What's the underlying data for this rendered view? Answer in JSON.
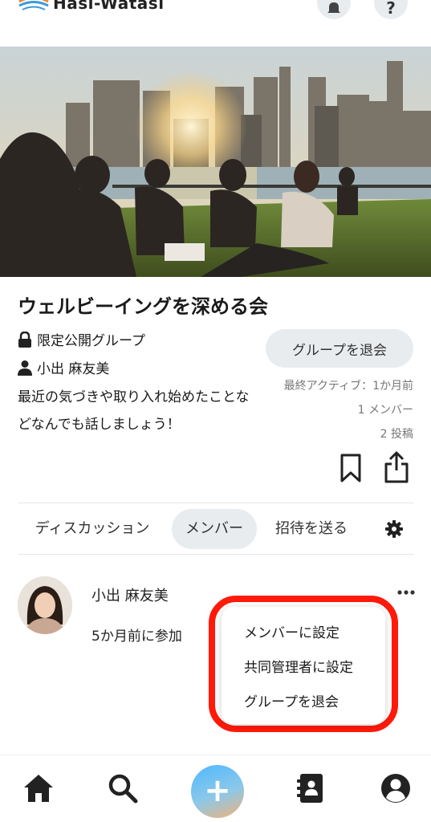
{
  "header": {
    "app_name": "Hasi-Watasi",
    "icons": [
      "logo-icon",
      "bell-icon",
      "help-icon"
    ],
    "help_symbol": "?"
  },
  "group": {
    "title": "ウェルビーイングを深める会",
    "privacy": "限定公開グループ",
    "owner": "小出 麻友美",
    "description": "最近の気づきや取り入れ始めたことなどなんでも話しましょう！",
    "leave_button": "グループを退会",
    "last_active": "最終アクティブ：1か月前",
    "member_count": "1 メンバー",
    "post_count": "2 投稿"
  },
  "tabs": [
    {
      "label": "ディスカッション",
      "active": false
    },
    {
      "label": "メンバー",
      "active": true
    },
    {
      "label": "招待を送る",
      "active": false
    }
  ],
  "member": {
    "name": "小出 麻友美",
    "joined": "5か月前に参加"
  },
  "context_menu": {
    "items": [
      "メンバーに設定",
      "共同管理者に設定",
      "グループを退会"
    ]
  },
  "bottom_nav": {
    "items": [
      "home-icon",
      "search-icon",
      "add-icon",
      "contacts-icon",
      "profile-icon"
    ],
    "add_symbol": "+"
  },
  "colors": {
    "highlight": "#ff1a0a",
    "pill_bg": "#e9ecef",
    "muted_text": "#777777"
  }
}
